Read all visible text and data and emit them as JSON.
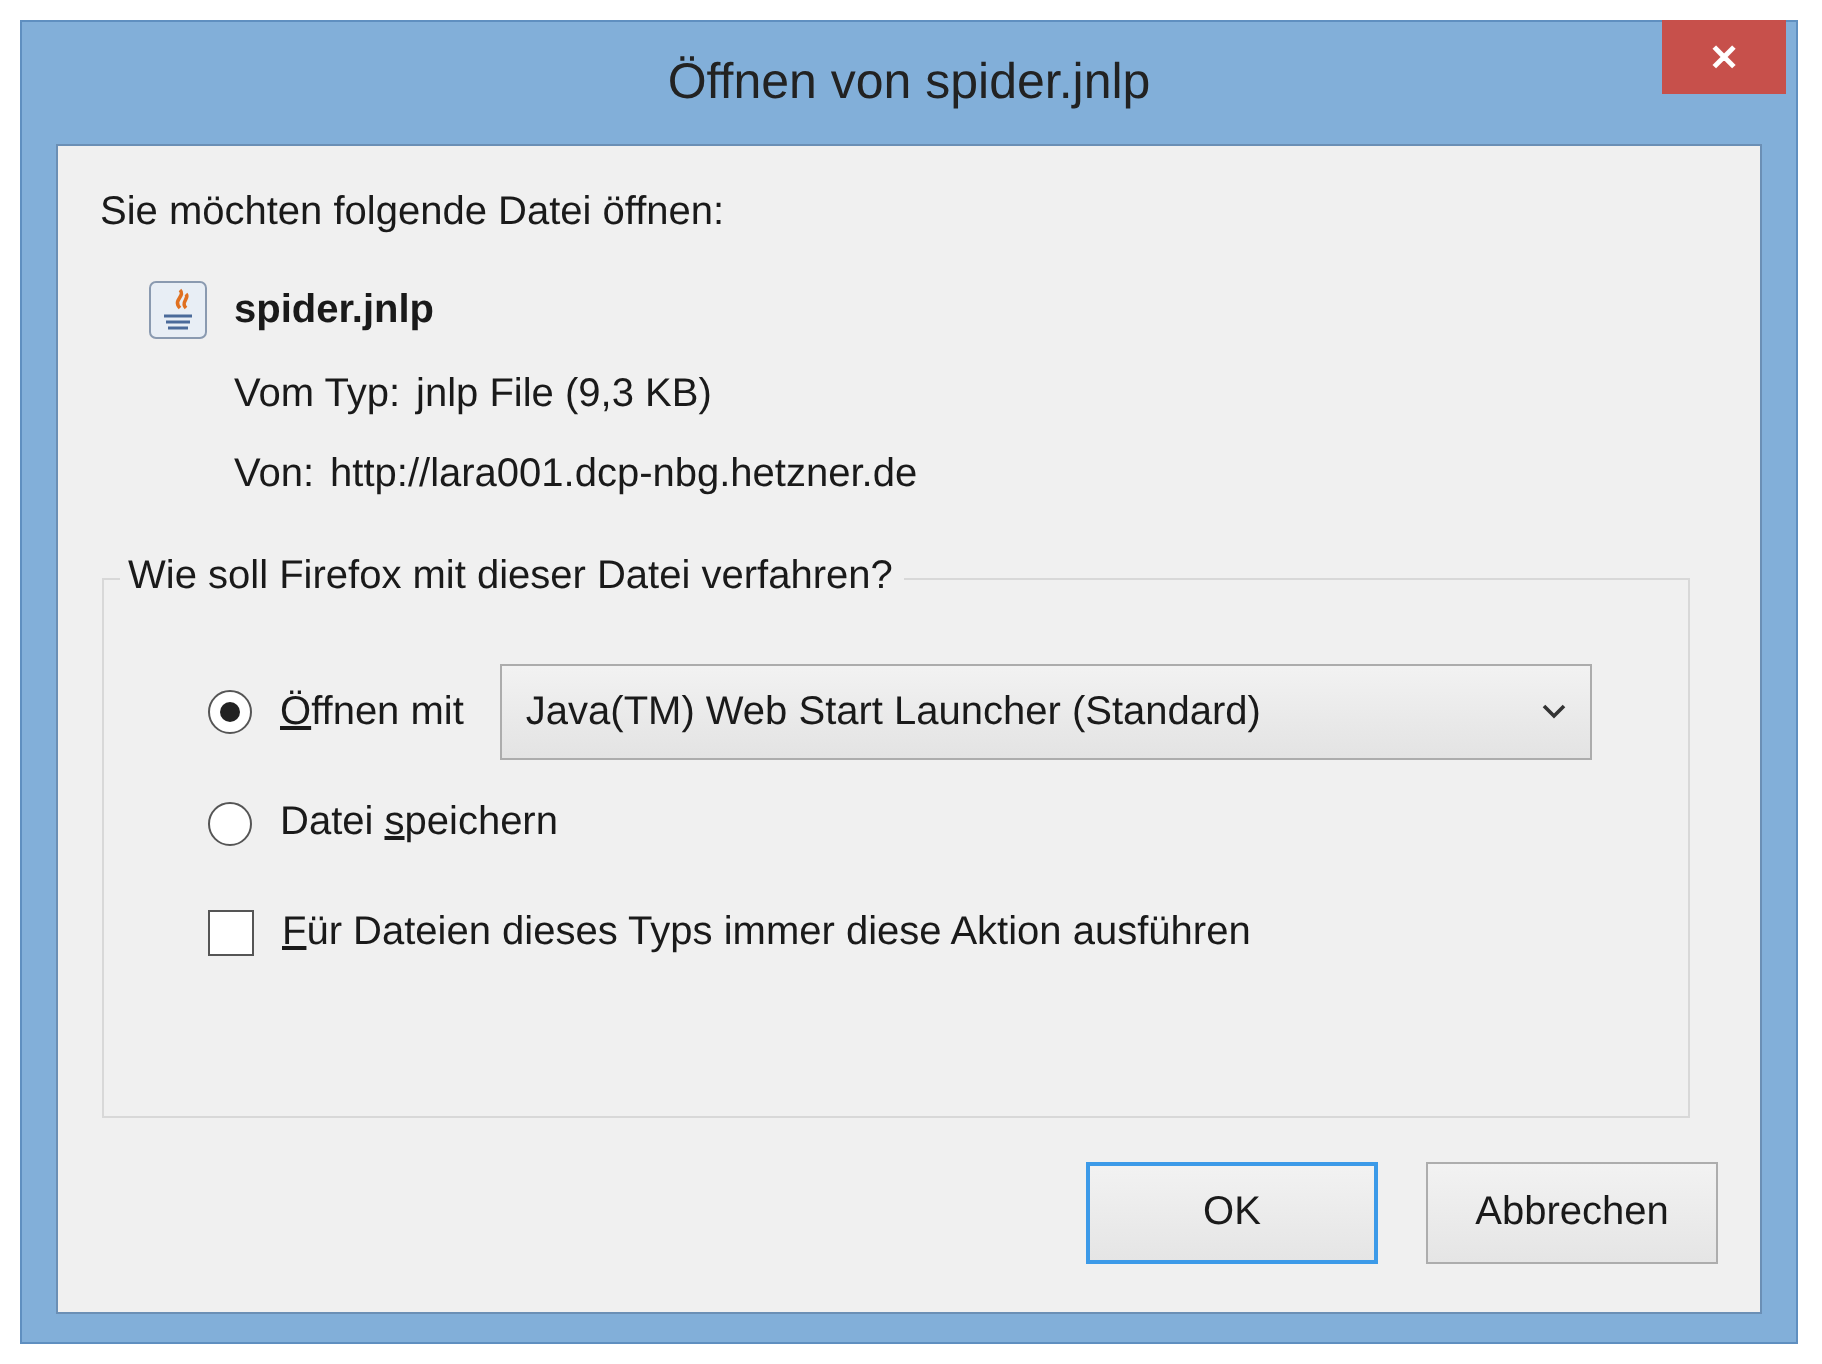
{
  "window": {
    "title": "Öffnen von spider.jnlp",
    "close": "✕"
  },
  "intro": "Sie möchten folgende Datei öffnen:",
  "file": {
    "name": "spider.jnlp",
    "details": [
      {
        "label": "Vom Typ:",
        "value": "jnlp File (9,3 KB)"
      },
      {
        "label": "Von:",
        "value": "http://lara001.dcp-nbg.hetzner.de"
      }
    ]
  },
  "group": {
    "legend": "Wie soll Firefox mit dieser Datei verfahren?",
    "options": [
      {
        "kind": "radio",
        "selected": true,
        "label": [
          {
            "text": "Ö",
            "underline": true
          },
          {
            "text": "ffnen mit",
            "underline": false
          }
        ],
        "dropdown": "Java(TM) Web Start Launcher (Standard)"
      },
      {
        "kind": "radio",
        "selected": false,
        "label": [
          {
            "text": "Datei ",
            "underline": false
          },
          {
            "text": "s",
            "underline": true
          },
          {
            "text": "peichern",
            "underline": false
          }
        ]
      },
      {
        "kind": "checkbox",
        "checked": false,
        "label": [
          {
            "text": "F",
            "underline": true
          },
          {
            "text": "ür Dateien dieses Typs immer diese Aktion ausführen",
            "underline": false
          }
        ]
      }
    ]
  },
  "buttons": [
    {
      "label": "OK",
      "focused": true
    },
    {
      "label": "Abbrechen",
      "focused": false
    }
  ]
}
